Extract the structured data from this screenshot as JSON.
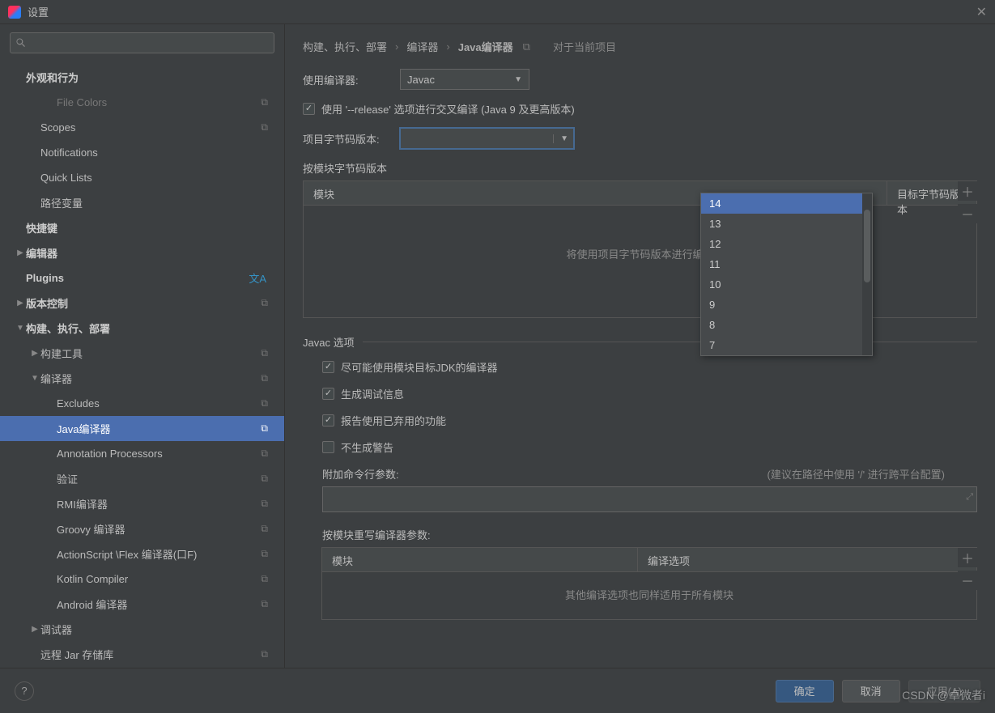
{
  "window": {
    "title": "设置",
    "scope_label": "对于当前项目"
  },
  "sidebar": {
    "search_placeholder": "",
    "items": [
      {
        "label": "外观和行为",
        "indent": 0,
        "bold": true,
        "arrow": "",
        "icon": ""
      },
      {
        "label": "File Colors",
        "indent": 2,
        "icon": "copy",
        "dim": true
      },
      {
        "label": "Scopes",
        "indent": 1,
        "icon": "copy"
      },
      {
        "label": "Notifications",
        "indent": 1,
        "icon": ""
      },
      {
        "label": "Quick Lists",
        "indent": 1,
        "icon": ""
      },
      {
        "label": "路径变量",
        "indent": 1,
        "icon": ""
      },
      {
        "label": "快捷键",
        "indent": 0,
        "bold": true
      },
      {
        "label": "编辑器",
        "indent": 0,
        "bold": true,
        "arrow": "▶"
      },
      {
        "label": "Plugins",
        "indent": 0,
        "bold": true,
        "icon": "lang"
      },
      {
        "label": "版本控制",
        "indent": 0,
        "bold": true,
        "arrow": "▶",
        "icon": "copy"
      },
      {
        "label": "构建、执行、部署",
        "indent": 0,
        "bold": true,
        "arrow": "▼"
      },
      {
        "label": "构建工具",
        "indent": 1,
        "arrow": "▶",
        "icon": "copy"
      },
      {
        "label": "编译器",
        "indent": 1,
        "arrow": "▼",
        "icon": "copy"
      },
      {
        "label": "Excludes",
        "indent": 2,
        "icon": "copy"
      },
      {
        "label": "Java编译器",
        "indent": 2,
        "icon": "copy",
        "selected": true
      },
      {
        "label": "Annotation Processors",
        "indent": 2,
        "icon": "copy"
      },
      {
        "label": "验证",
        "indent": 2,
        "icon": "copy"
      },
      {
        "label": "RMI编译器",
        "indent": 2,
        "icon": "copy"
      },
      {
        "label": "Groovy 编译器",
        "indent": 2,
        "icon": "copy"
      },
      {
        "label": "ActionScript \\Flex 编译器(口F)",
        "indent": 2,
        "icon": "copy"
      },
      {
        "label": "Kotlin Compiler",
        "indent": 2,
        "icon": "copy"
      },
      {
        "label": "Android 编译器",
        "indent": 2,
        "icon": "copy"
      },
      {
        "label": "调试器",
        "indent": 1,
        "arrow": "▶"
      },
      {
        "label": "远程 Jar 存储库",
        "indent": 1,
        "icon": "copy"
      }
    ]
  },
  "breadcrumb": [
    "构建、执行、部署",
    "编译器",
    "Java编译器"
  ],
  "form": {
    "compiler_label": "使用编译器:",
    "compiler_value": "Javac",
    "release_checkbox": "使用 '--release' 选项进行交叉编译 (Java 9 及更高版本)",
    "bytecode_label": "项目字节码版本:",
    "bytecode_value": "",
    "per_module_label": "按模块字节码版本",
    "table1": {
      "col1": "模块",
      "col2": "目标字节码版本",
      "placeholder": "将使用项目字节码版本进行编译"
    },
    "javac_section": "Javac 选项",
    "cb1": "尽可能使用模块目标JDK的编译器",
    "cb2": "生成调试信息",
    "cb3": "报告使用已弃用的功能",
    "cb4": "不生成警告",
    "cmdline_label": "附加命令行参数:",
    "cmdline_hint": "(建议在路径中使用 '/' 进行跨平台配置)",
    "override_label": "按模块重写编译器参数:",
    "table2": {
      "col1": "模块",
      "col2": "编译选项",
      "placeholder": "其他编译选项也同样适用于所有模块"
    }
  },
  "dropdown": {
    "options": [
      "14",
      "13",
      "12",
      "11",
      "10",
      "9",
      "8",
      "7"
    ],
    "selected": "14"
  },
  "footer": {
    "ok": "确定",
    "cancel": "取消",
    "apply": "应用(A)"
  },
  "watermark": "CSDN @卓微者i"
}
